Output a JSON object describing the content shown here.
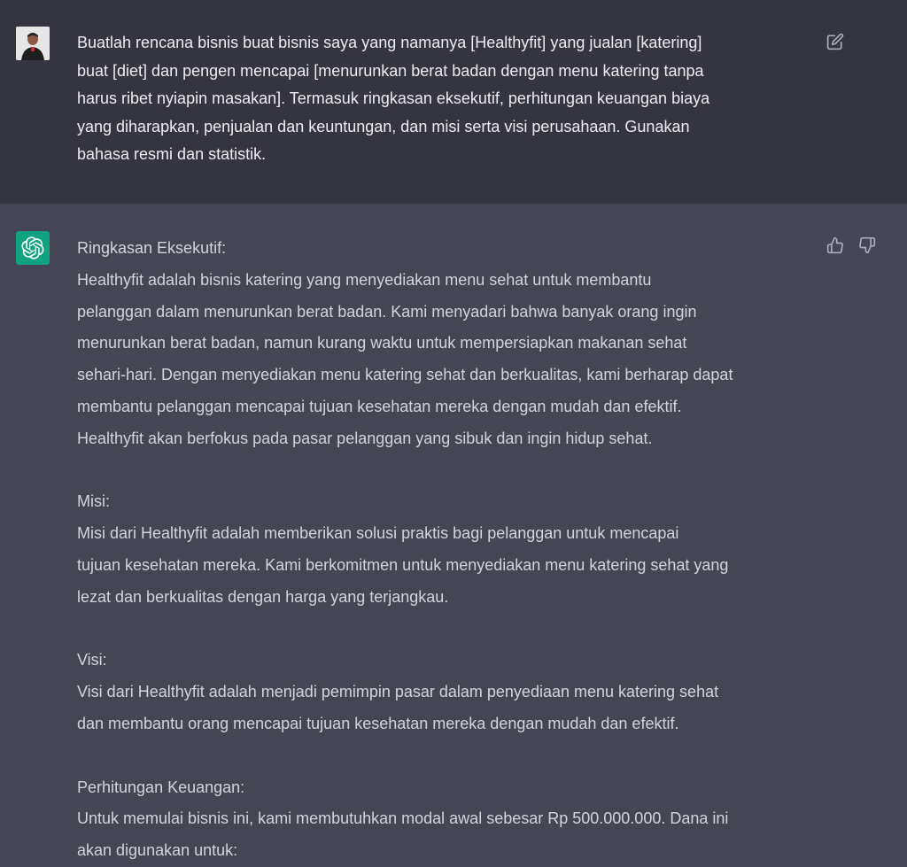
{
  "user_message": {
    "avatar": "user-photo",
    "text": "Buatlah rencana bisnis buat bisnis saya yang namanya [Healthyfit] yang jualan [katering]\nbuat [diet] dan pengen mencapai [menurunkan berat badan dengan menu katering tanpa\nharus ribet nyiapin masakan]. Termasuk ringkasan eksekutif, perhitungan keuangan biaya\nyang diharapkan, penjualan dan keuntungan, dan misi serta visi perusahaan. Gunakan\nbahasa resmi dan statistik.",
    "edit_icon": "edit-icon"
  },
  "assistant_message": {
    "avatar": "openai-logo-icon",
    "paragraphs": [
      "Ringkasan Eksekutif:\nHealthyfit adalah bisnis katering yang menyediakan menu sehat untuk membantu\npelanggan dalam menurunkan berat badan. Kami menyadari bahwa banyak orang ingin\nmenurunkan berat badan, namun kurang waktu untuk mempersiapkan makanan sehat\nsehari-hari. Dengan menyediakan menu katering sehat dan berkualitas, kami berharap dapat\nmembantu pelanggan mencapai tujuan kesehatan mereka dengan mudah dan efektif.\nHealthyfit akan berfokus pada pasar pelanggan yang sibuk dan ingin hidup sehat.",
      "Misi:\nMisi dari Healthyfit adalah memberikan solusi praktis bagi pelanggan untuk mencapai\ntujuan kesehatan mereka. Kami berkomitmen untuk menyediakan menu katering sehat yang\nlezat dan berkualitas dengan harga yang terjangkau.",
      "Visi:\nVisi dari Healthyfit adalah menjadi pemimpin pasar dalam penyediaan menu katering sehat\ndan membantu orang mencapai tujuan kesehatan mereka dengan mudah dan efektif.",
      "Perhitungan Keuangan:\nUntuk memulai bisnis ini, kami membutuhkan modal awal sebesar Rp 500.000.000. Dana ini\nakan digunakan untuk:"
    ],
    "thumbs_up_icon": "thumbs-up-icon",
    "thumbs_down_icon": "thumbs-down-icon"
  },
  "colors": {
    "user_bg": "#343541",
    "assistant_bg": "#444654",
    "bot_avatar": "#10a37f",
    "text": "#d1d5db"
  }
}
